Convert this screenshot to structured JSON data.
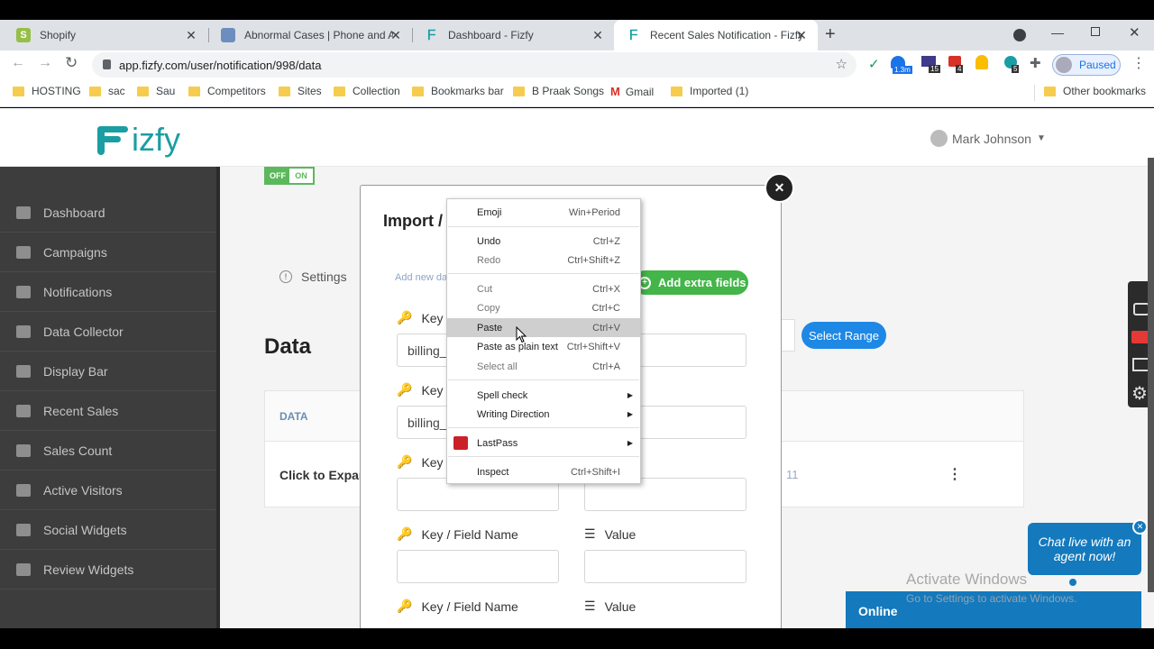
{
  "browser": {
    "tabs": [
      {
        "title": "Shopify",
        "icon": "shopify-icon",
        "color": "#95bf47",
        "active": false
      },
      {
        "title": "Abnormal Cases | Phone and Air",
        "icon": "document-icon",
        "color": "#6c8ebf",
        "active": false
      },
      {
        "title": "Dashboard - Fizfy",
        "icon": "fizfy-icon",
        "color": "#1a9ea3",
        "active": false
      },
      {
        "title": "Recent Sales Notification - Fizfy",
        "icon": "fizfy-icon",
        "color": "#1a9ea3",
        "active": true
      }
    ],
    "new_tab": "+",
    "url": "app.fizfy.com/user/notification/998/data",
    "profile_status": "Paused",
    "ext_badges": [
      "1.3m",
      "15",
      "4",
      "5"
    ],
    "bookmarks": [
      "HOSTING",
      "sac",
      "Sau",
      "Competitors",
      "Sites",
      "Collection",
      "Bookmarks bar",
      "B Praak Songs",
      "Gmail",
      "Imported (1)"
    ],
    "other_bookmarks": "Other bookmarks"
  },
  "app": {
    "logo_text": "izfy",
    "user_name": "Mark Johnson",
    "toggle": {
      "off": "OFF",
      "on": "ON"
    },
    "sidebar": [
      "Dashboard",
      "Campaigns",
      "Notifications",
      "Data Collector",
      "Display Bar",
      "Recent Sales",
      "Sales Count",
      "Active Visitors",
      "Social Widgets",
      "Review Widgets"
    ],
    "settings_label": "Settings",
    "data_title": "Data",
    "select_range": "Select Range",
    "table_header": "DATA",
    "row_text": "Click to Expan",
    "row_value": "11"
  },
  "modal": {
    "title": "Import /",
    "hint": "Add new da",
    "add_extra": "Add extra fields",
    "key_label": "Key /",
    "key_label_full": "Key / Field Name",
    "value_label": "Value",
    "field1": "billing_",
    "field2": "billing_"
  },
  "context_menu": {
    "emoji": {
      "label": "Emoji",
      "shortcut": "Win+Period"
    },
    "undo": {
      "label": "Undo",
      "shortcut": "Ctrl+Z"
    },
    "redo": {
      "label": "Redo",
      "shortcut": "Ctrl+Shift+Z"
    },
    "cut": {
      "label": "Cut",
      "shortcut": "Ctrl+X"
    },
    "copy": {
      "label": "Copy",
      "shortcut": "Ctrl+C"
    },
    "paste": {
      "label": "Paste",
      "shortcut": "Ctrl+V"
    },
    "paste_plain": {
      "label": "Paste as plain text",
      "shortcut": "Ctrl+Shift+V"
    },
    "select_all": {
      "label": "Select all",
      "shortcut": "Ctrl+A"
    },
    "spell": {
      "label": "Spell check"
    },
    "writing": {
      "label": "Writing Direction"
    },
    "lastpass": {
      "label": "LastPass"
    },
    "inspect": {
      "label": "Inspect",
      "shortcut": "Ctrl+Shift+I"
    }
  },
  "chat": {
    "bubble": "Chat live with an agent now!",
    "status": "Online"
  },
  "watermark": {
    "title": "Activate Windows",
    "sub": "Go to Settings to activate Windows."
  }
}
